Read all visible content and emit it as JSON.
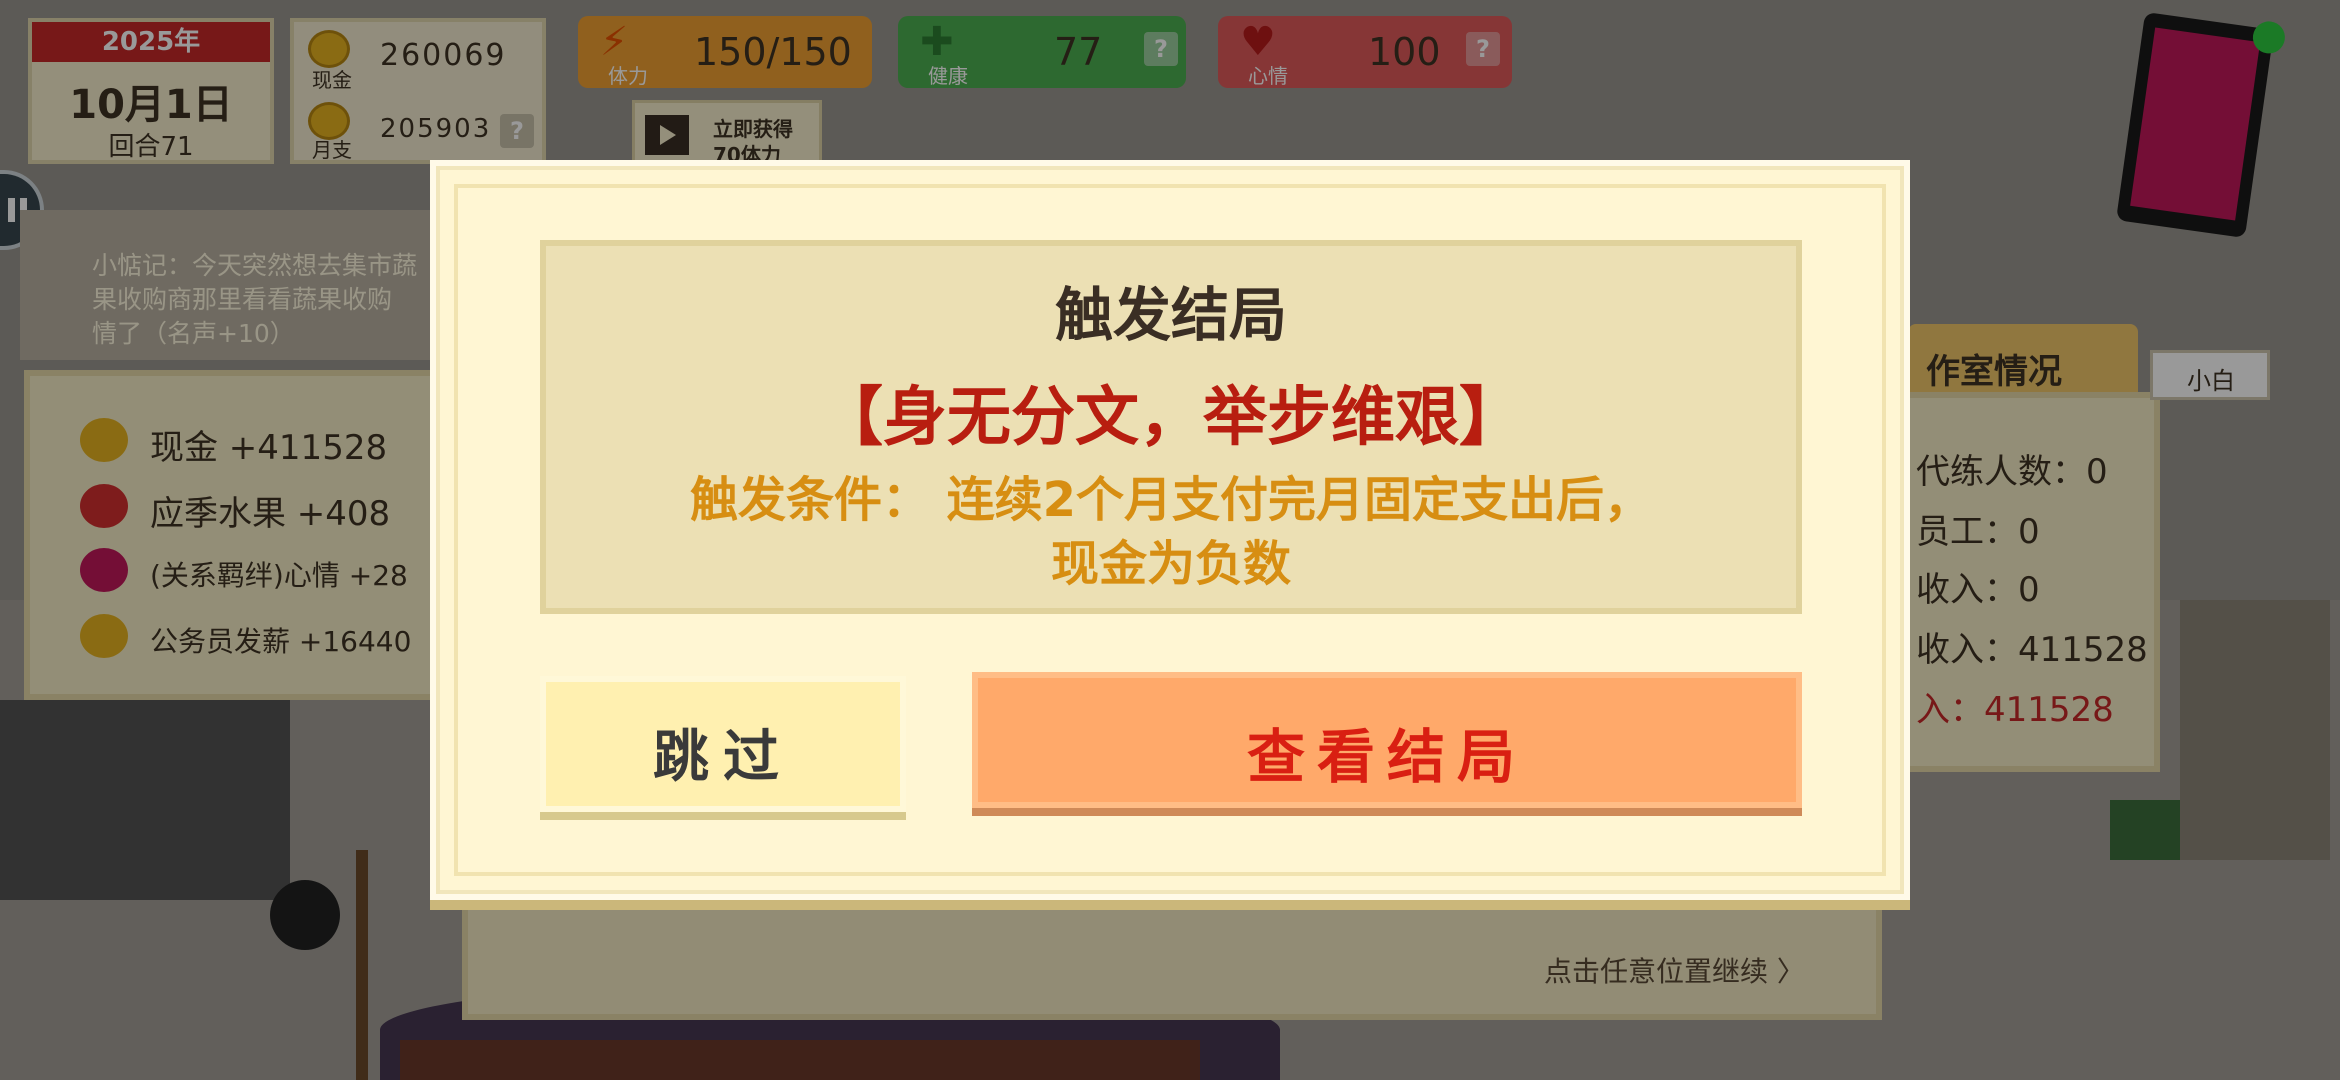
{
  "hud": {
    "year": "2025年",
    "date": "10月1日",
    "turn": "回合71",
    "cash_label": "现金",
    "cash_value": "260069",
    "monthly_label": "月支",
    "monthly_value": "205903",
    "help_mark": "?",
    "stamina_label": "体力",
    "stamina_value": "150/150",
    "health_label": "健康",
    "health_value": "77",
    "mood_label": "心情",
    "mood_value": "100",
    "video_line1": "立即获得",
    "video_line2": "70体力"
  },
  "diary": {
    "line1": "小惦记：今天突然想去集市蔬",
    "line2": "果收购商那里看看蔬果收购",
    "line3": "情了（名声+10）"
  },
  "income": [
    {
      "icon": "coin-icon",
      "text": "现金 +411528"
    },
    {
      "icon": "fruit-icon",
      "text": "应季水果 +408"
    },
    {
      "icon": "heart-icon",
      "text": "(关系羁绊)心情 +28"
    },
    {
      "icon": "coin-icon",
      "text": "公务员发薪 +16440"
    }
  ],
  "studio": {
    "tab_title": "作室情况",
    "name_tag": "小白",
    "lines": [
      "代练人数：0",
      "员工：0",
      "收入：0",
      "收入：411528",
      "入：411528"
    ]
  },
  "continue_hint": "点击任意位置继续 〉",
  "modal": {
    "title": "触发结局",
    "ending_name": "【身无分文，举步维艰】",
    "condition_line1": "触发条件：  连续2个月支付完月固定支出后，",
    "condition_line2": "现金为负数",
    "skip_label": "跳过",
    "view_label": "查看结局"
  },
  "colors": {
    "ending_red": "#b81e10",
    "condition_orange": "#d78e12",
    "view_button": "#ffa96a",
    "skip_button": "#fff0b0"
  }
}
